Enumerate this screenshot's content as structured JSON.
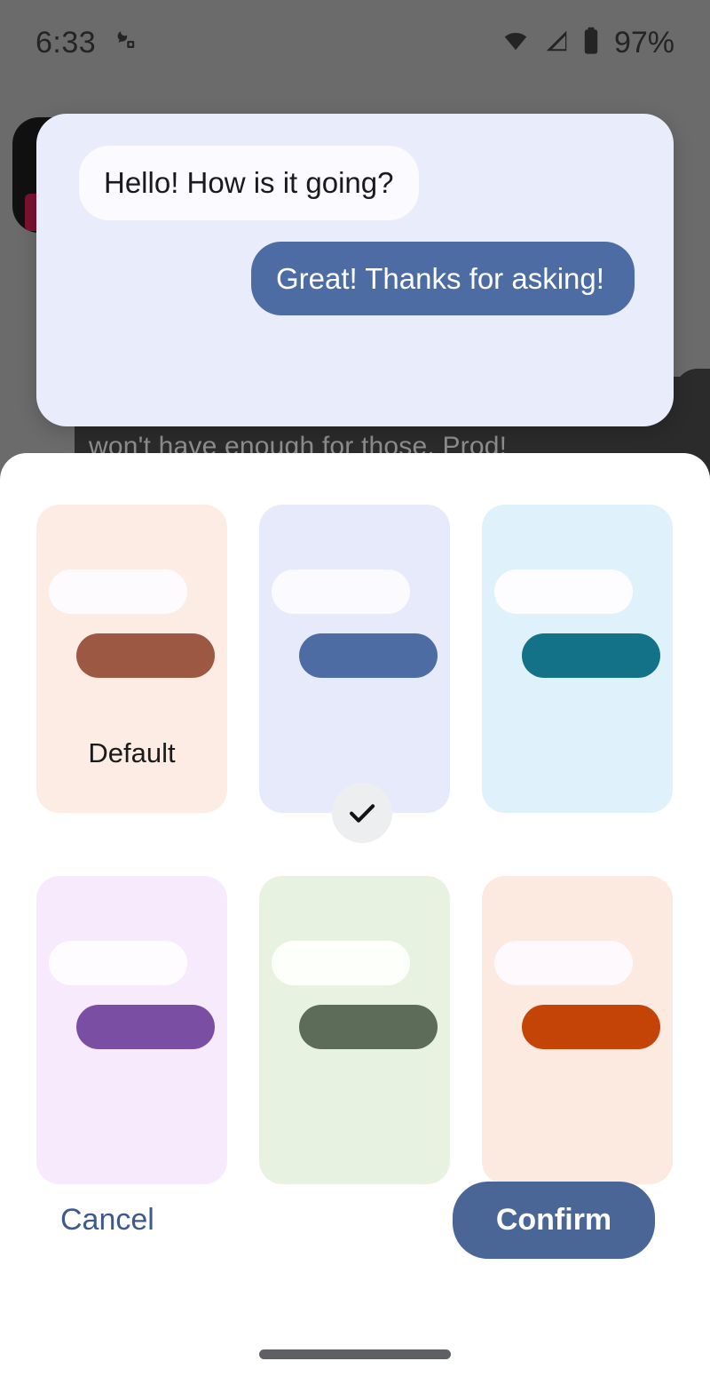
{
  "status_bar": {
    "time": "6:33",
    "battery_percent": "97%",
    "icons": [
      "app-notification-icon",
      "wifi-icon",
      "cellular-signal-icon",
      "battery-icon"
    ]
  },
  "background_app": {
    "clipped_text": "won't have enough for those. Prod!"
  },
  "preview_card": {
    "background_color": "#e9edfb",
    "incoming_message": "Hello! How is it going?",
    "outgoing_message": "Great! Thanks for asking!",
    "incoming_bubble_color": "#fbfaff",
    "outgoing_bubble_color": "#4d6ca3"
  },
  "sheet": {
    "themes": [
      {
        "id": "default",
        "label": "Default",
        "card_color": "#fcece4",
        "bubble_color": "#fdfbfd",
        "accent_color": "#9c5842",
        "selected": false
      },
      {
        "id": "blue",
        "label": "",
        "card_color": "#e6eafb",
        "bubble_color": "#fbfaff",
        "accent_color": "#4d6ca3",
        "selected": true
      },
      {
        "id": "teal",
        "label": "",
        "card_color": "#dff1fb",
        "bubble_color": "#fdfdff",
        "accent_color": "#137287",
        "selected": false
      },
      {
        "id": "purple",
        "label": "",
        "card_color": "#f7eafc",
        "bubble_color": "#fefcff",
        "accent_color": "#7a4fa3",
        "selected": false
      },
      {
        "id": "green",
        "label": "",
        "card_color": "#e8f2e0",
        "bubble_color": "#fdfffb",
        "accent_color": "#5d6c58",
        "selected": false
      },
      {
        "id": "orange",
        "label": "",
        "card_color": "#fce9e0",
        "bubble_color": "#fdf9fd",
        "accent_color": "#c44407",
        "selected": false
      }
    ],
    "selected_badge_icon": "check-icon",
    "cancel_label": "Cancel",
    "confirm_label": "Confirm",
    "cancel_color": "#3d5a8f",
    "confirm_color": "#4a6697"
  }
}
